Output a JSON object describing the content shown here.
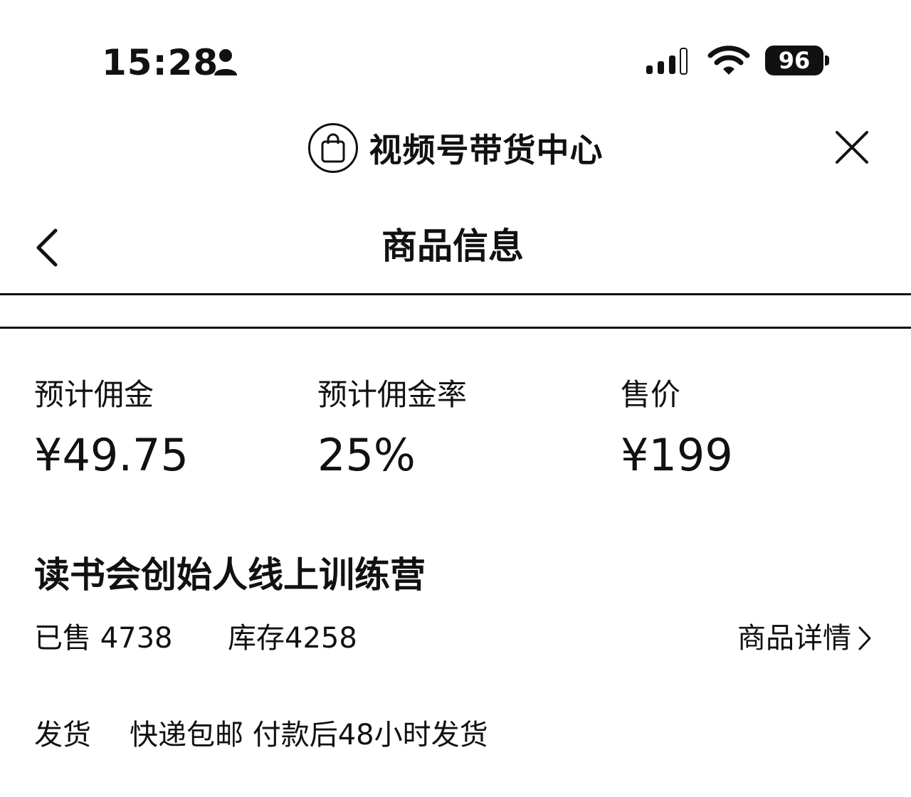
{
  "status_bar": {
    "time": "15:28",
    "battery": "96"
  },
  "mini_program": {
    "title": "视频号带货中心"
  },
  "nav": {
    "title": "商品信息"
  },
  "stats": [
    {
      "label": "预计佣金",
      "value": "¥49.75"
    },
    {
      "label": "预计佣金率",
      "value": "25%"
    },
    {
      "label": "售价",
      "value": "¥199"
    }
  ],
  "product": {
    "name": "读书会创始人线上训练营",
    "sold": "已售 4738",
    "stock": "库存4258",
    "details_label": "商品详情"
  },
  "shipping": {
    "label": "发货",
    "value": "快递包邮 付款后48小时发货"
  }
}
